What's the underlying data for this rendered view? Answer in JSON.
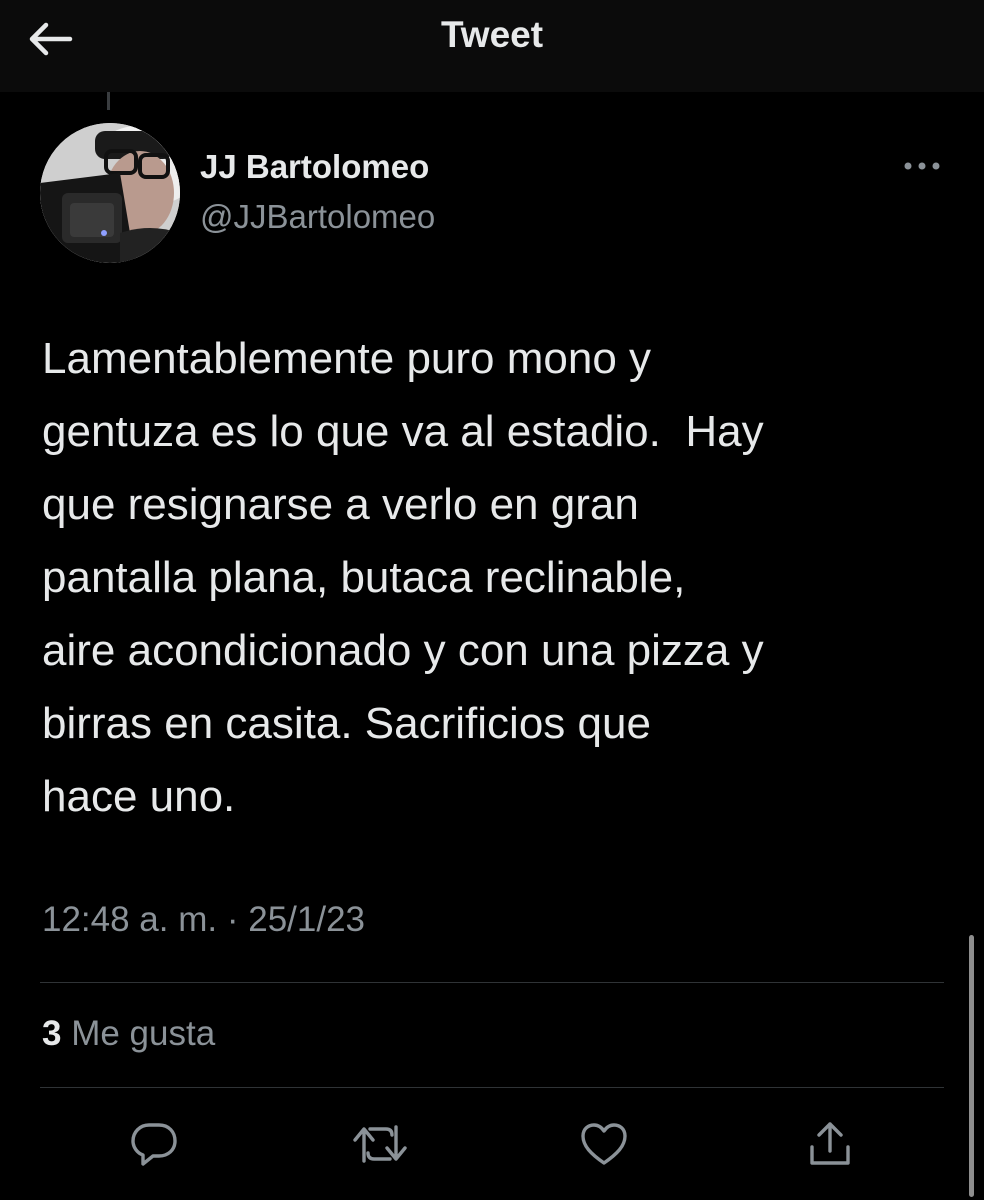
{
  "header": {
    "title": "Tweet",
    "back_icon": "arrow-left-icon"
  },
  "tweet": {
    "author_name": "JJ Bartolomeo",
    "author_handle": "@JJBartolomeo",
    "text": "Lamentablemente puro mono y\ngentuza es lo que va al estadio.  Hay\nque resignarse a verlo en gran\npantalla plana, butaca reclinable,\naire acondicionado y con una pizza y\nbirras en casita. Sacrificios que\nhace uno.",
    "time": "12:48 a. m.",
    "separator": "·",
    "date": "25/1/23",
    "likes_count": "3",
    "likes_label": "Me gusta"
  },
  "actions": [
    "reply-icon",
    "retweet-icon",
    "like-icon",
    "share-icon"
  ],
  "colors": {
    "background": "#000000",
    "text": "#e7e9ea",
    "secondary_text": "#8b9298",
    "divider": "#2f3336"
  }
}
